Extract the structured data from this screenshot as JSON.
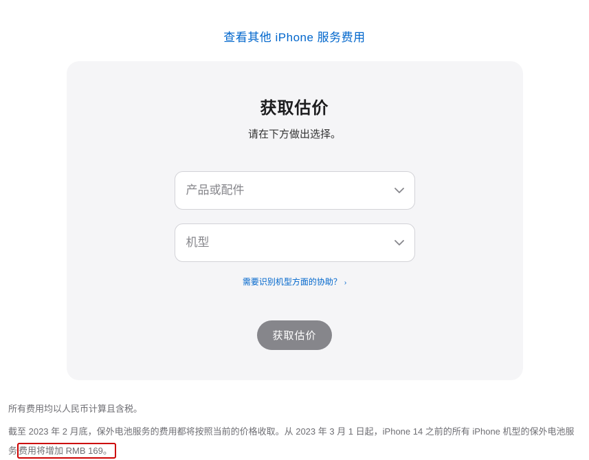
{
  "top_link": {
    "text": "查看其他 iPhone 服务费用"
  },
  "card": {
    "title": "获取估价",
    "subtitle": "请在下方做出选择。",
    "select_product": {
      "placeholder": "产品或配件"
    },
    "select_model": {
      "placeholder": "机型"
    },
    "help_link": {
      "text": "需要识别机型方面的协助？"
    },
    "submit_label": "获取估价"
  },
  "notes": {
    "line1": "所有费用均以人民币计算且含税。",
    "line2_pre": "截至 2023 年 2 月底，保外电池服务的费用都将按照当前的价格收取。从 2023 年 3 月 1 日起，iPhone 14 之前的所有 iPhone 机型的保外电池服务",
    "line2_box": "费用将增加 RMB 169。"
  }
}
